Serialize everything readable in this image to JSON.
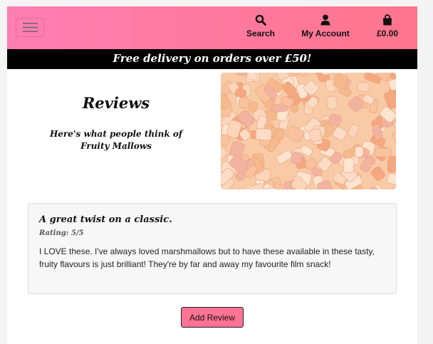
{
  "colors": {
    "navbar_gradient_start": "#ff7eb3",
    "navbar_gradient_end": "#ff758c",
    "banner_bg": "#000000",
    "button_bg": "#ff7394"
  },
  "navbar": {
    "toggler_icon": "hamburger-icon",
    "search": {
      "icon": "search-icon",
      "label": "Search"
    },
    "account": {
      "icon": "user-icon",
      "label": "My Account"
    },
    "bag": {
      "icon": "shopping-bag-icon",
      "label": "£0.00"
    }
  },
  "banner": {
    "text": "Free delivery on orders over £50!"
  },
  "header": {
    "title": "Reviews",
    "subtitle": "Here's what people think of Fruity Mallows"
  },
  "review": {
    "title": "A great twist on a classic.",
    "rating": "Rating: 5/5",
    "body": "I LOVE these. I've always loved marshmallows but to have these available in these tasty, fruity flavours is just brilliant! They're by far and away my favourite film snack!"
  },
  "actions": {
    "add_review_label": "Add Review"
  }
}
